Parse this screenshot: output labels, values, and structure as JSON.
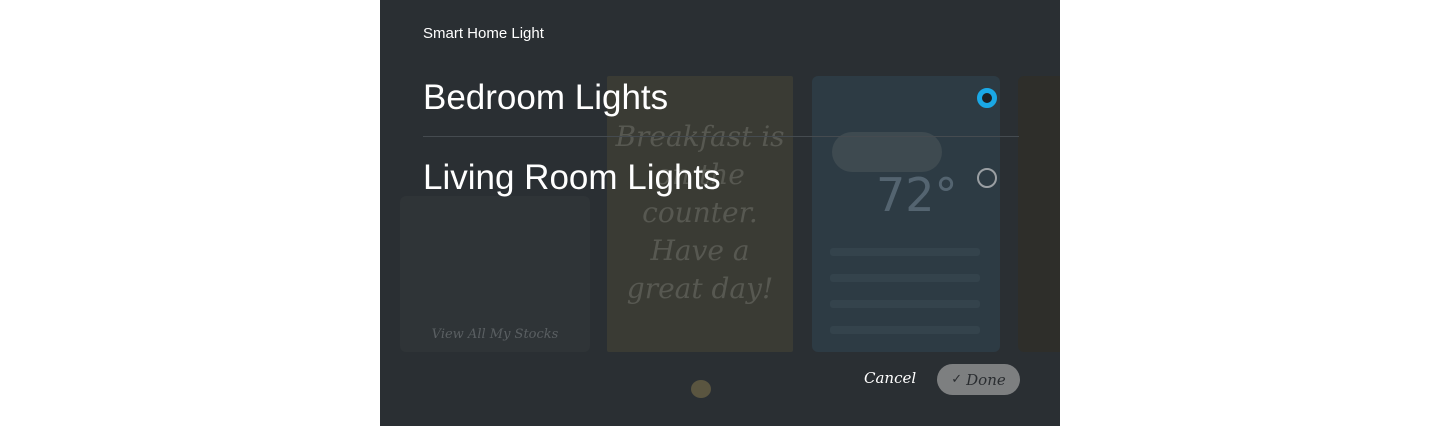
{
  "background": {
    "stocks_link": "View All My Stocks",
    "note_text": "Breakfast is on the counter. Have a great day!",
    "weather_temp": "72°"
  },
  "dialog": {
    "title": "Smart Home Light",
    "options": [
      {
        "label": "Bedroom Lights",
        "selected": true
      },
      {
        "label": "Living Room Lights",
        "selected": false
      }
    ],
    "cancel_label": "Cancel",
    "done_label": "Done",
    "done_icon": "check-icon"
  },
  "colors": {
    "accent": "#1aa8e6",
    "overlay": "#2a2f33",
    "done_button": "#7d7f80"
  }
}
